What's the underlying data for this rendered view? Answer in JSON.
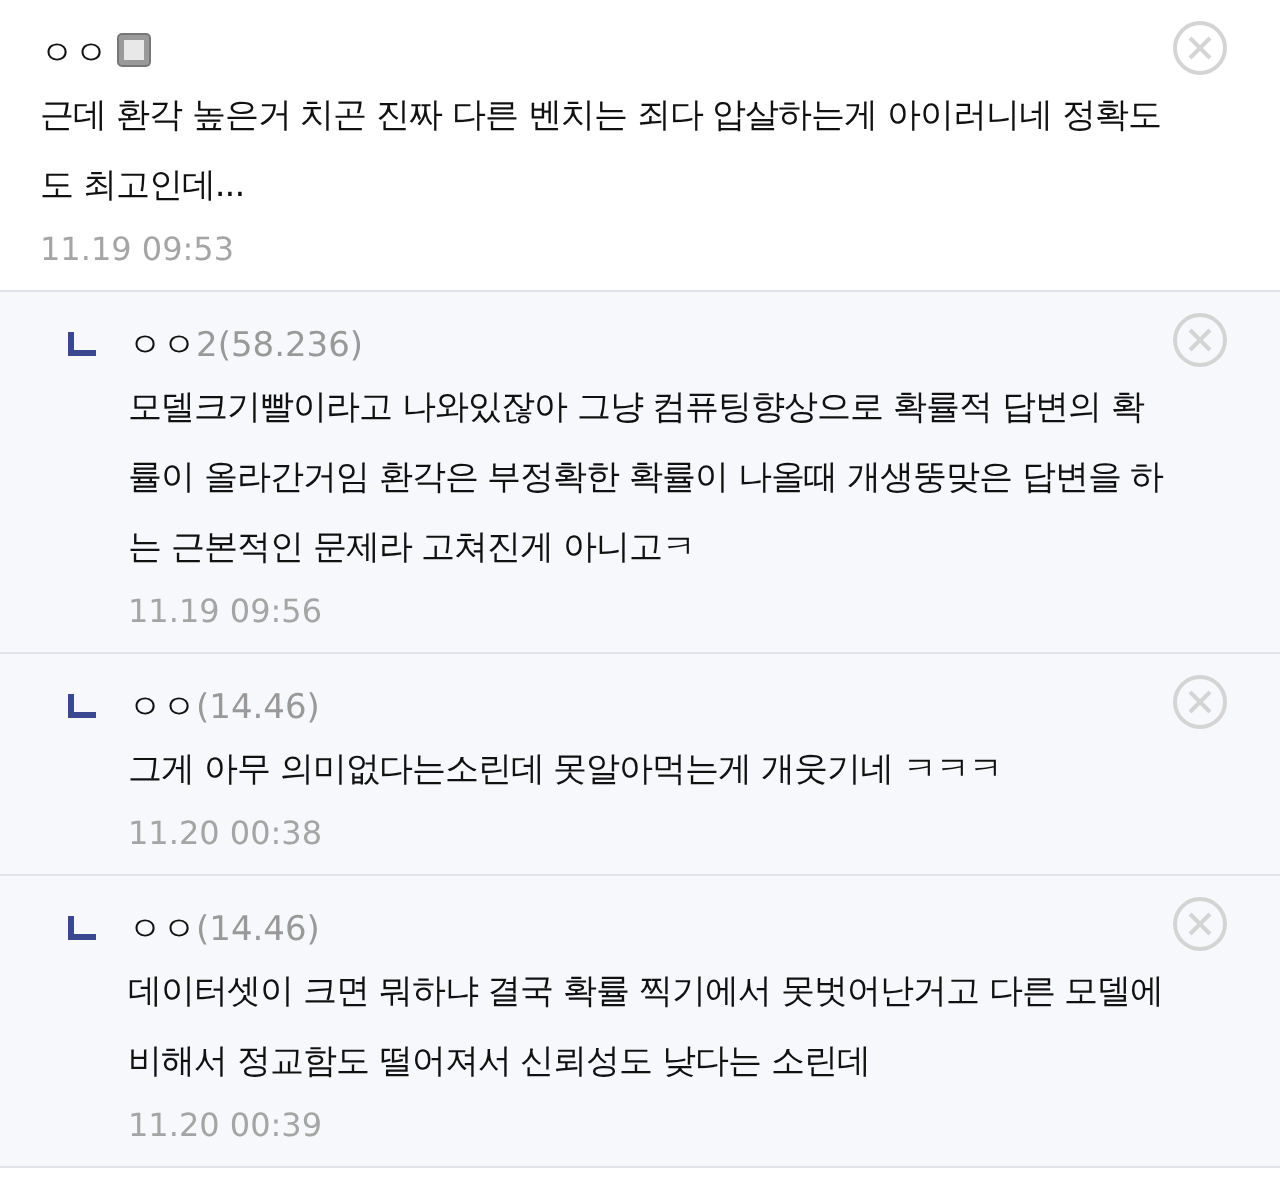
{
  "comments": [
    {
      "kind": "comment",
      "name": "ㅇㅇ",
      "fixed_icon": true,
      "text": "근데 환각 높은거 치곤 진짜 다른 벤치는 죄다 압살하는게 아이러니네 정확도도 최고인데...",
      "time": "11.19 09:53"
    },
    {
      "kind": "reply",
      "name": "ㅇㅇ",
      "ip": "2(58.236)",
      "fixed_icon": false,
      "text": "모델크기빨이라고 나와있잖아 그냥 컴퓨팅향상으로 확률적 답변의 확률이 올라간거임 환각은 부정확한 확률이 나올때 개생뚱맞은 답변을 하는 근본적인 문제라 고쳐진게 아니고ㅋ",
      "time": "11.19 09:56"
    },
    {
      "kind": "reply",
      "name": "ㅇㅇ",
      "ip": "(14.46)",
      "fixed_icon": false,
      "text": "그게 아무 의미없다는소린데 못알아먹는게 개웃기네 ㅋㅋㅋ",
      "time": "11.20 00:38"
    },
    {
      "kind": "reply",
      "name": "ㅇㅇ",
      "ip": "(14.46)",
      "fixed_icon": false,
      "text": "데이터셋이 크면 뭐하냐 결국 확률 찍기에서 못벗어난거고 다른 모델에 비해서 정교함도 떨어져서 신뢰성도 낮다는 소린데",
      "time": "11.20 00:39"
    }
  ]
}
